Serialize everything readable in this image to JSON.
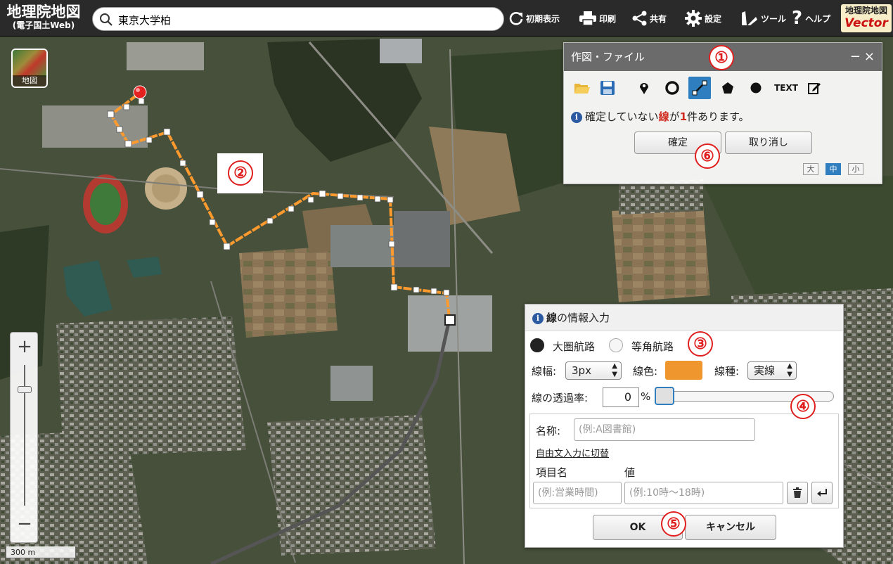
{
  "header": {
    "logo_line1": "地理院地図",
    "logo_line2": "(電子国土Web)",
    "search_value": "東京大学柏",
    "buttons": [
      {
        "label": "初期表示",
        "icon": "refresh-icon"
      },
      {
        "label": "印刷",
        "icon": "print-icon"
      },
      {
        "label": "共有",
        "icon": "share-icon"
      },
      {
        "label": "設定",
        "icon": "gear-icon"
      },
      {
        "label": "ツール",
        "icon": "tool-icon"
      },
      {
        "label": "ヘルプ",
        "icon": "help-icon"
      }
    ],
    "vector_badge_line1": "地理院地図",
    "vector_badge_line2": "Vector"
  },
  "map": {
    "layer_button_label": "地図",
    "zoom_in": "+",
    "zoom_out": "−",
    "scale_label": "300 m",
    "route_color": "#f0962e"
  },
  "draw_panel": {
    "title": "作図・ファイル",
    "minimize": "−",
    "close": "×",
    "tools": [
      "open-file-icon",
      "save-icon",
      "marker-icon",
      "circle-icon",
      "line-icon",
      "polygon-icon",
      "dot-icon",
      "text-icon",
      "edit-icon"
    ],
    "text_tool_label": "TEXT",
    "message_pre": "確定していない",
    "message_kind": "線",
    "message_mid": "が",
    "message_count": "1",
    "message_post": "件あります。",
    "confirm_button": "確定",
    "cancel_button": "取り消し",
    "size_buttons": [
      "大",
      "中",
      "小"
    ],
    "selected_size": "中"
  },
  "info_dialog": {
    "title_bold": "線",
    "title_rest": "の情報入力",
    "route_great_circle": "大圏航路",
    "route_rhumb": "等角航路",
    "width_label": "線幅:",
    "width_value": "3px",
    "color_label": "線色:",
    "line_color": "#f0962e",
    "type_label": "線種:",
    "type_value": "実線",
    "opacity_label": "線の透過率:",
    "opacity_value": "0",
    "opacity_unit": "%",
    "name_label": "名称:",
    "name_placeholder": "(例:A図書館)",
    "free_text_link": "自由文入力に切替",
    "item_name_header": "項目名",
    "value_header": "値",
    "item_placeholder": "(例:営業時間)",
    "value_placeholder": "(例:10時〜18時)",
    "ok_button": "OK",
    "cancel_button": "キャンセル"
  },
  "callouts": [
    "①",
    "②",
    "③",
    "④",
    "⑤",
    "⑥"
  ]
}
